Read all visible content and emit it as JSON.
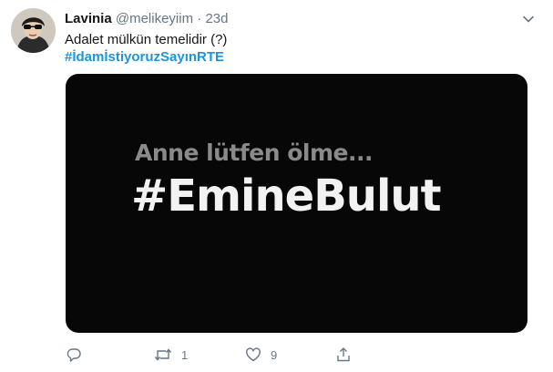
{
  "tweet": {
    "author_name": "Lavinia",
    "author_handle": "@melikeyiim",
    "separator": "·",
    "timestamp": "23d",
    "text": "Adalet mülkün temelidir (?)",
    "hashtag": "#İdamİstiyoruzSayınRTE"
  },
  "media": {
    "subtitle": "Anne lütfen ölme...",
    "headline": "#EmineBulut"
  },
  "actions": {
    "reply_count": "",
    "retweet_count": "1",
    "like_count": "9"
  },
  "icons": {
    "caret": "chevron-down-icon",
    "reply": "reply-icon",
    "retweet": "retweet-icon",
    "like": "heart-icon",
    "share": "share-icon"
  },
  "colors": {
    "link": "#1b95e0",
    "muted": "#657786",
    "text": "#14171a",
    "media_bg": "#070707"
  }
}
